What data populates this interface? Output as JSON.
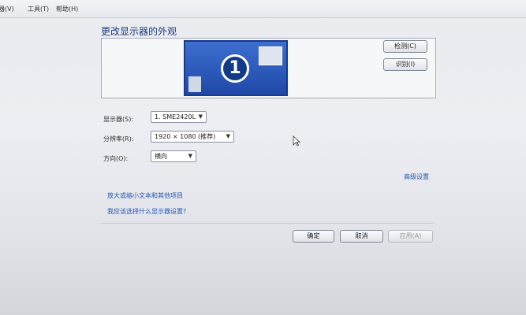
{
  "menu": [
    "器(V)",
    "工具(T)",
    "帮助(H)"
  ],
  "title": "更改显示器的外观",
  "preview": {
    "monitor_number": "1"
  },
  "buttons": {
    "detect": "检测(C)",
    "identify": "识别(I)"
  },
  "fields": {
    "display": {
      "label": "显示器(S):",
      "value": "1. SME2420L"
    },
    "resolution": {
      "label": "分辨率(R):",
      "value": "1920 × 1080 (推荐)"
    },
    "orientation": {
      "label": "方向(O):",
      "value": "横向"
    }
  },
  "links": {
    "advanced": "高级设置",
    "text_size": "放大或缩小文本和其他项目",
    "which_settings": "我应该选择什么显示器设置?"
  },
  "footer": {
    "ok": "确定",
    "cancel": "取消",
    "apply": "应用(A)"
  },
  "colors": {
    "link": "#2658b0",
    "monitor": "#1f48a8",
    "title": "#1b3a7a"
  }
}
